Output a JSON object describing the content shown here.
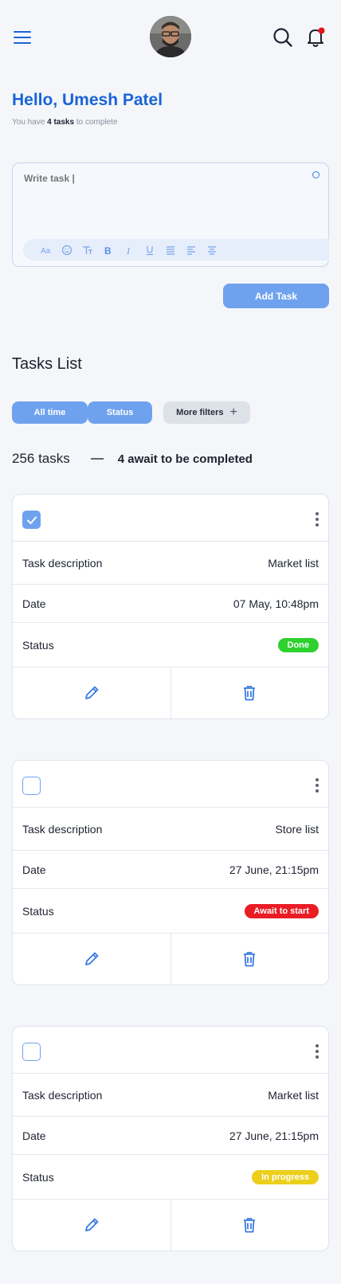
{
  "header": {
    "menu_icon": "hamburger-icon",
    "avatar": "user-avatar",
    "search_icon": "search-icon",
    "notification_icon": "bell-icon"
  },
  "greeting": {
    "title": "Hello, Umesh Patel",
    "subtitle_prefix": "You have ",
    "subtitle_count": "4 tasks",
    "subtitle_suffix": " to complete"
  },
  "editor": {
    "placeholder": "Write task |",
    "toolbar": [
      "font-size-icon",
      "emoji-icon",
      "text-style-icon",
      "bold-icon",
      "italic-icon",
      "underline-icon",
      "justify-icon",
      "align-left-icon",
      "align-center-icon"
    ]
  },
  "add_button": "Add Task",
  "tasks_section": {
    "title": "Tasks List",
    "filters": [
      "All time",
      "Status",
      "More filters"
    ],
    "count": "256 tasks",
    "await_text": "4 await to be completed"
  },
  "labels": {
    "description": "Task description",
    "date": "Date",
    "status": "Status"
  },
  "tasks": [
    {
      "checked": true,
      "description": "Market list",
      "date": "07 May, 10:48pm",
      "status": "Done",
      "status_color": "#2ed12e"
    },
    {
      "checked": false,
      "description": "Store list",
      "date": "27 June, 21:15pm",
      "status": "Await to start",
      "status_color": "#ea1c24"
    },
    {
      "checked": false,
      "description": "Market list",
      "date": "27 June, 21:15pm",
      "status": "In progress",
      "status_color": "#ebcf1c"
    }
  ],
  "colors": {
    "accent": "#1a64d6",
    "button": "#6fa2ee",
    "notification_dot": "#e8141c"
  }
}
